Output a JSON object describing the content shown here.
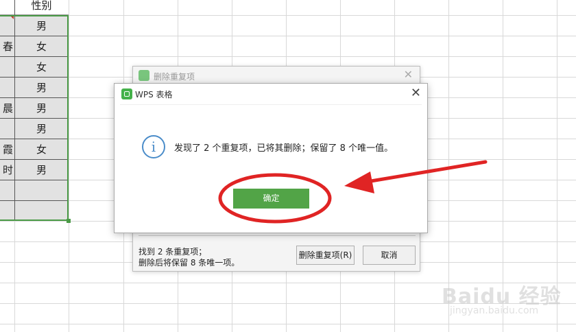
{
  "sheet": {
    "header_label": "性别",
    "col_a_fragments": [
      "",
      "春",
      "",
      "",
      "晨",
      "",
      "霞",
      "时"
    ],
    "col_b_values": [
      "男",
      "女",
      "女",
      "男",
      "男",
      "男",
      "女",
      "男"
    ],
    "selection_color": "#4a9a46"
  },
  "back_dialog": {
    "title": "删除重复项",
    "close_glyph": "✕",
    "found_line": "找到 2 条重复项；",
    "keep_line": "删除后将保留 8 条唯一项。",
    "remove_button": "删除重复项(R)",
    "cancel_button": "取消"
  },
  "front_dialog": {
    "title": "WPS 表格",
    "close_glyph": "✕",
    "info_glyph": "i",
    "message": "发现了 2 个重复项，已将其删除；保留了 8 个唯一值。",
    "ok_button": "确定",
    "ok_color": "#52a447"
  },
  "annotation_color": "#e02424",
  "watermark": {
    "brand": "Baidu 经验",
    "url": "jingyan.baidu.com"
  }
}
